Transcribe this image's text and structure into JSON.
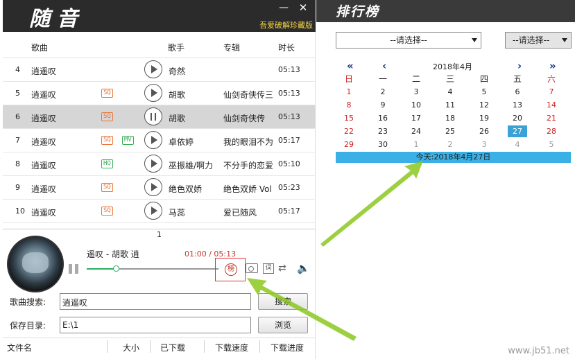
{
  "player": {
    "logo": "随音",
    "edition": "吾爱破解珍藏版",
    "minimize": "—",
    "close": "✕",
    "columns": {
      "song": "歌曲",
      "singer": "歌手",
      "album": "专辑",
      "duration": "时长"
    },
    "rows": [
      {
        "num": "4",
        "name": "逍遥叹",
        "tags": [],
        "singer": "奇然",
        "album": "",
        "time": "05:13",
        "selected": false
      },
      {
        "num": "5",
        "name": "逍遥叹",
        "tags": [
          "SQ"
        ],
        "singer": "胡歌",
        "album": "仙剑奇侠传三",
        "time": "05:13",
        "selected": false
      },
      {
        "num": "6",
        "name": "逍遥叹",
        "tags": [
          "SQ"
        ],
        "singer": "胡歌",
        "album": "仙剑奇侠传",
        "time": "05:13",
        "selected": true
      },
      {
        "num": "7",
        "name": "逍遥叹",
        "tags": [
          "SQ",
          "MV"
        ],
        "singer": "卓依婷",
        "album": "我的眼泪不为",
        "time": "05:17",
        "selected": false
      },
      {
        "num": "8",
        "name": "逍遥叹",
        "tags": [
          "HQ"
        ],
        "singer": "巫振雄/啊力",
        "album": "不分手的恋爱",
        "time": "05:10",
        "selected": false
      },
      {
        "num": "9",
        "name": "逍遥叹",
        "tags": [
          "SQ"
        ],
        "singer": "绝色双娇",
        "album": "绝色双娇 Vol",
        "time": "05:23",
        "selected": false
      },
      {
        "num": "10",
        "name": "逍遥叹",
        "tags": [
          "SQ"
        ],
        "singer": "马蕊",
        "album": "爱已随风",
        "time": "05:17",
        "selected": false
      }
    ],
    "page": "1",
    "now_playing": "遥叹 - 胡歌  逍",
    "time": "01:00 / 05:13",
    "progress": 0.22,
    "bang_icon": "榜",
    "lyric_icon": "词",
    "mode_icon": "⇄",
    "volume_icon": "🔈",
    "search_label": "歌曲搜索:",
    "search_value": "逍遥叹",
    "search_button": "搜索",
    "save_label": "保存目录:",
    "save_value": "E:\\1",
    "browse_button": "浏览",
    "download_columns": [
      "文件名",
      "大小",
      "已下载",
      "下载速度",
      "下载进度"
    ]
  },
  "ranking": {
    "title": "排行榜",
    "select1": "--请选择--",
    "select2": "--请选择--",
    "nav": {
      "prev_year": "«",
      "prev_month": "‹",
      "next_month": "›",
      "next_year": "»"
    },
    "month_label": "2018年4月",
    "weekdays": [
      "日",
      "一",
      "二",
      "三",
      "四",
      "五",
      "六"
    ],
    "weeks": [
      [
        "1",
        "2",
        "3",
        "4",
        "5",
        "6",
        "7"
      ],
      [
        "8",
        "9",
        "10",
        "11",
        "12",
        "13",
        "14"
      ],
      [
        "15",
        "16",
        "17",
        "18",
        "19",
        "20",
        "21"
      ],
      [
        "22",
        "23",
        "24",
        "25",
        "26",
        "27",
        "28"
      ],
      [
        "29",
        "30",
        "1",
        "2",
        "3",
        "4",
        "5"
      ]
    ],
    "selected_day": "27",
    "today_text": "今天:2018年4月27日"
  },
  "watermark": "www.jb51.net",
  "colors": {
    "accent_red": "#d02020",
    "highlight_blue": "#3ab0e6",
    "arrow_green": "#8cc81e",
    "sq_tag": "#e8763a",
    "hq_tag": "#3cae5a"
  }
}
